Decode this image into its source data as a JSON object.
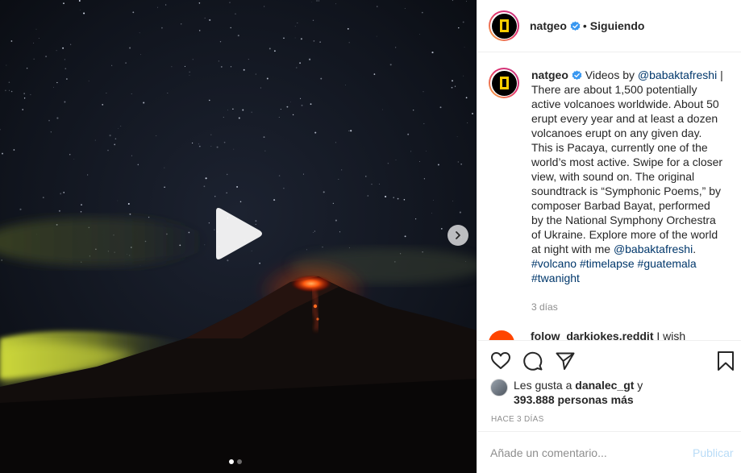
{
  "post": {
    "username": "natgeo",
    "header_separator": "•",
    "follow_status": "Siguiendo",
    "caption": {
      "username": "natgeo",
      "lead": " Videos by ",
      "mention_1": "@babaktafreshi",
      "body": " | There are about 1,500 potentially active volcanoes worldwide. About 50 erupt every year and at least a dozen volcanoes erupt on any given day. This is Pacaya, currently one of the world’s most active. Swipe for a closer view, with sound on. The original soundtrack is “Symphonic Poems,” by composer Barbad Bayat, performed by the National Symphony Orchestra of Ukraine. Explore more of the world at night with me ",
      "mention_2": "@babaktafreshi",
      "end": ".",
      "hashtags": [
        "#volcano",
        "#timelapse",
        "#guatemala",
        "#twanight"
      ]
    },
    "caption_age": "3 días",
    "next_comment": {
      "username": "folow_darkjokes.reddit",
      "text": " I wish"
    },
    "likes": {
      "prefix": "Les gusta a ",
      "first_user": "danalec_gt",
      "joiner": " y",
      "count_text": "393.888 personas más"
    },
    "timestamp": "Hace 3 días",
    "composer": {
      "placeholder": "Añade un comentario...",
      "submit_label": "Publicar"
    },
    "carousel": {
      "slide_count": 2,
      "active_index": 0
    }
  },
  "icons": {
    "play": "play-icon",
    "next": "chevron-right-icon",
    "like": "heart-icon",
    "comment": "comment-icon",
    "share": "paper-plane-icon",
    "save": "bookmark-icon",
    "verified": "verified-badge-icon"
  },
  "colors": {
    "link": "#00376b",
    "verified": "#3897f0",
    "muted": "#8e8e8e",
    "lava": "#ff5a10"
  }
}
